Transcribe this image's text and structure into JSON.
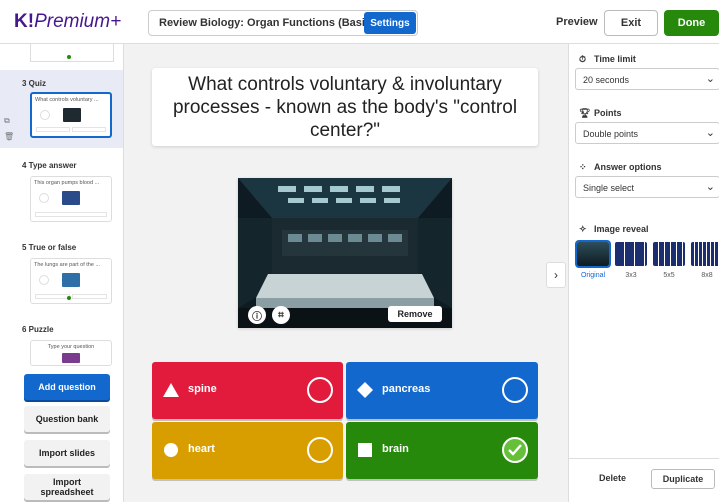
{
  "header": {
    "logo_k": "K!",
    "logo_premium": "Premium+",
    "quiz_title": "Review Biology: Organ Functions (Basic)",
    "settings_label": "Settings",
    "preview_label": "Preview",
    "exit_label": "Exit",
    "done_label": "Done"
  },
  "sidebar": {
    "slides": [
      {
        "label": "3 Quiz",
        "thumb_text": "What controls voluntary ..."
      },
      {
        "label": "4 Type answer",
        "thumb_text": "This organ pumps blood ..."
      },
      {
        "label": "5 True or false",
        "thumb_text": "The lungs are part of the ..."
      },
      {
        "label": "6 Puzzle",
        "thumb_text": "Type your question"
      }
    ],
    "add_question": "Add question",
    "question_bank": "Question bank",
    "import_slides": "Import slides",
    "import_spreadsheet_1": "Import",
    "import_spreadsheet_2": "spreadsheet"
  },
  "main": {
    "question": "What controls voluntary & involuntary processes - known as the body's \"control center?\"",
    "remove_label": "Remove",
    "answers": [
      {
        "text": "spine",
        "color": "#e21b3c",
        "shape": "triangle",
        "correct": false
      },
      {
        "text": "pancreas",
        "color": "#1368ce",
        "shape": "diamond",
        "correct": false
      },
      {
        "text": "heart",
        "color": "#d89e00",
        "shape": "circle",
        "correct": false
      },
      {
        "text": "brain",
        "color": "#26890c",
        "shape": "square",
        "correct": true
      }
    ]
  },
  "right_panel": {
    "time_limit_heading": "Time limit",
    "time_limit_value": "20 seconds",
    "points_heading": "Points",
    "points_value": "Double points",
    "answer_options_heading": "Answer options",
    "answer_options_value": "Single select",
    "image_reveal_heading": "Image reveal",
    "reveal_options": [
      "Original",
      "3x3",
      "5x5",
      "8x8"
    ],
    "delete_label": "Delete",
    "duplicate_label": "Duplicate"
  },
  "colors": {
    "brand_purple": "#46178f",
    "primary_blue": "#1368ce",
    "done_green": "#26890c",
    "correct_green": "#66bf39"
  }
}
